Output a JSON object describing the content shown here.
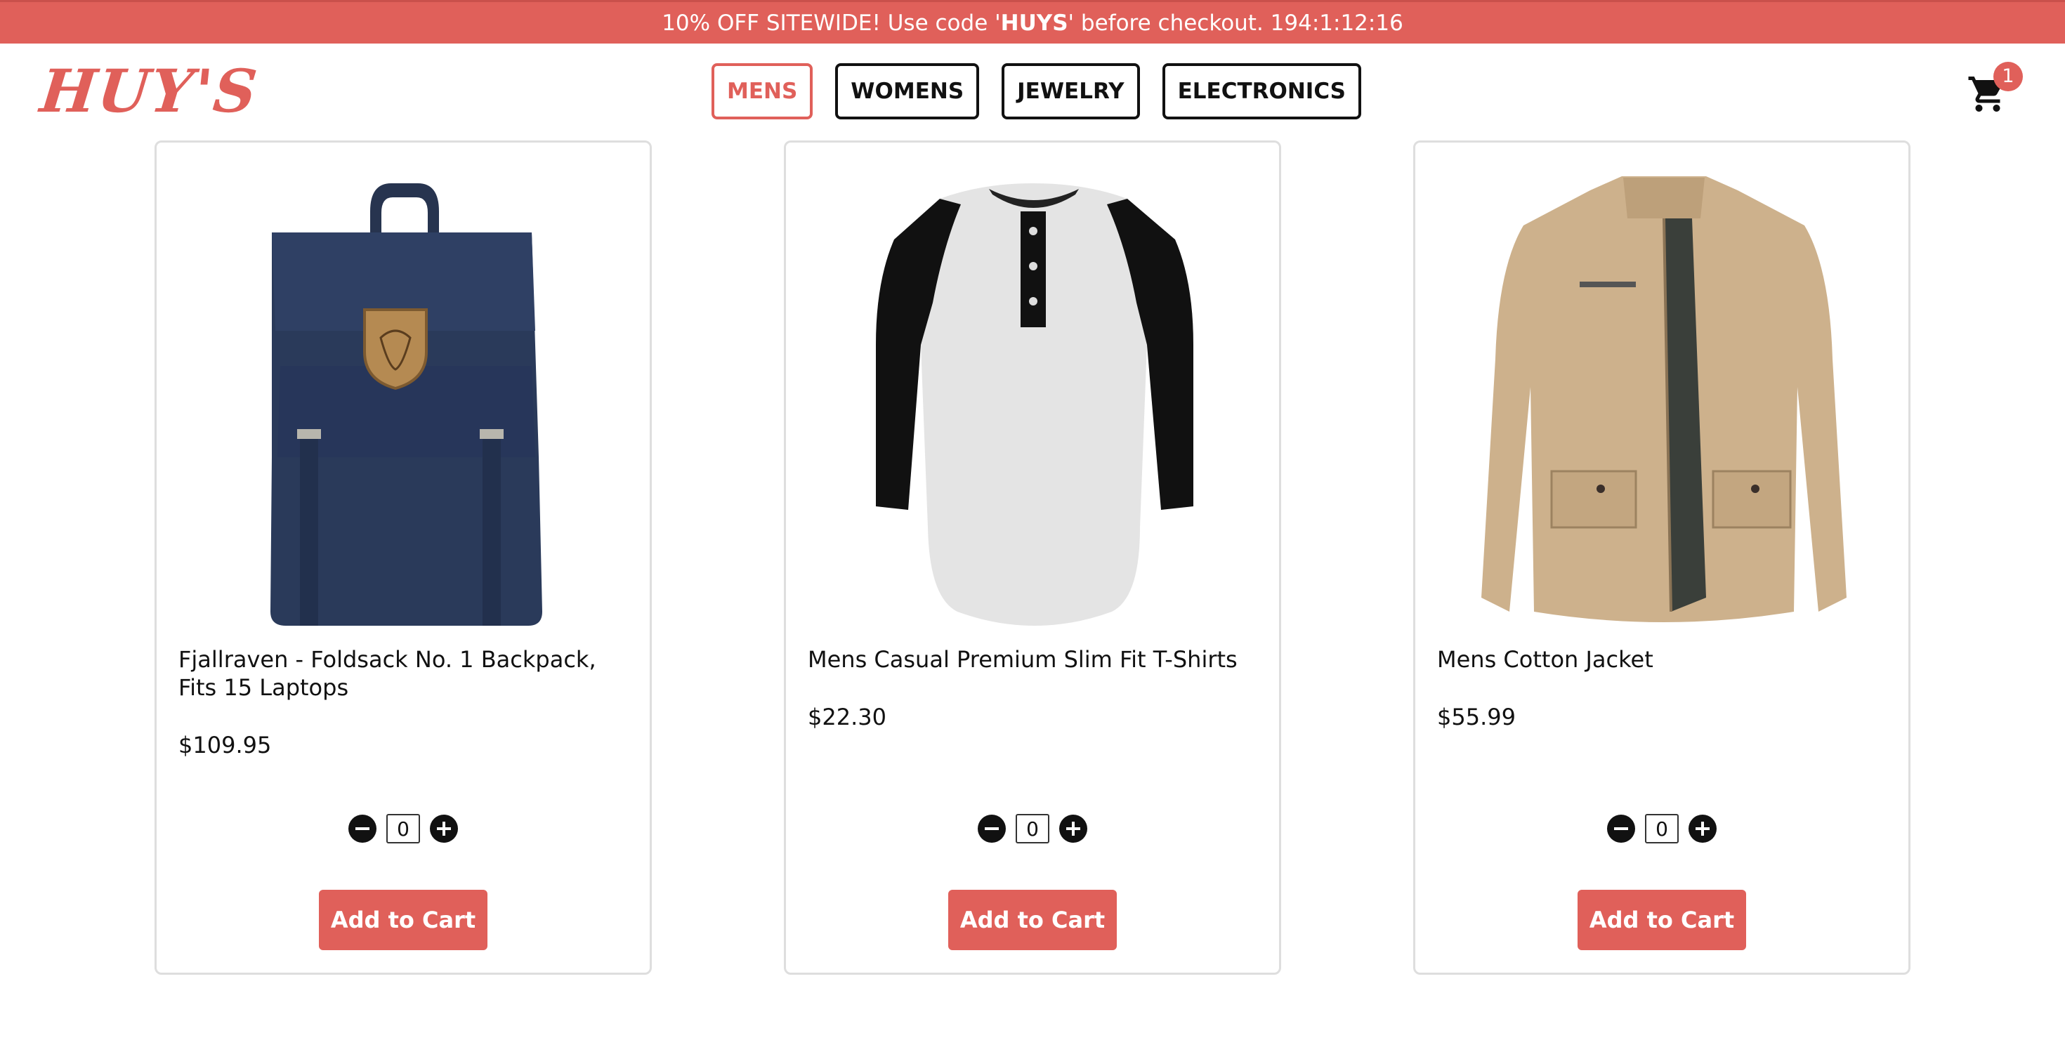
{
  "promo": {
    "prefix": "10% OFF SITEWIDE! Use code '",
    "code": "HUYS",
    "suffix": "' before checkout. 194:1:12:16"
  },
  "brand": {
    "logo_text": "HUY'S",
    "color": "#e0605a"
  },
  "nav": {
    "tabs": [
      {
        "label": "MENS",
        "active": true
      },
      {
        "label": "WOMENS",
        "active": false
      },
      {
        "label": "JEWELRY",
        "active": false
      },
      {
        "label": "ELECTRONICS",
        "active": false
      }
    ]
  },
  "cart": {
    "icon": "shopping-cart-icon",
    "count": "1"
  },
  "products": [
    {
      "title": "Fjallraven - Foldsack No. 1 Backpack, Fits 15 Laptops",
      "price": "$109.95",
      "image": "navy-backpack",
      "quantity": "0",
      "add_label": "Add to Cart"
    },
    {
      "title": "Mens Casual Premium Slim Fit T-Shirts",
      "price": "$22.30",
      "image": "raglan-henley-tshirt",
      "quantity": "0",
      "add_label": "Add to Cart"
    },
    {
      "title": "Mens Cotton Jacket",
      "price": "$55.99",
      "image": "khaki-cotton-jacket",
      "quantity": "0",
      "add_label": "Add to Cart"
    }
  ],
  "colors": {
    "accent": "#e0605a",
    "text": "#111111",
    "card_border": "#dedede"
  }
}
